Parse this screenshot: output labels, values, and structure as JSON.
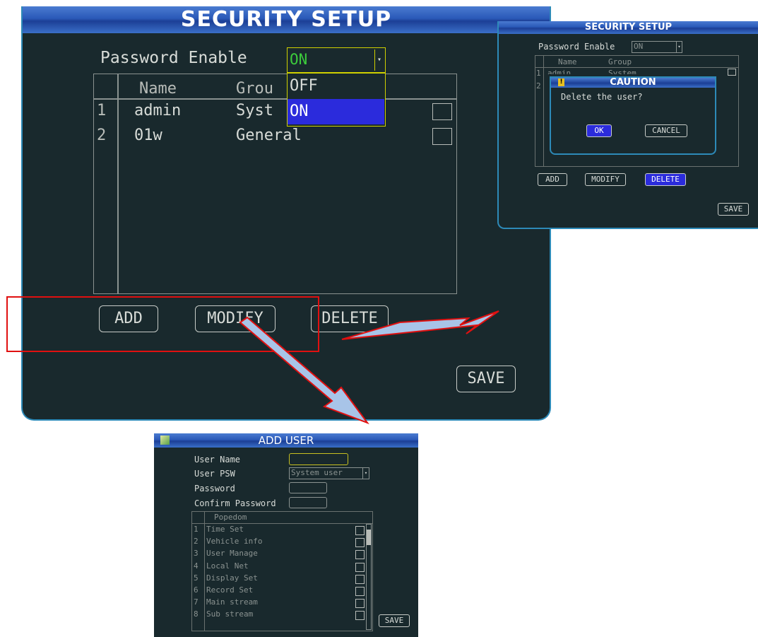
{
  "main": {
    "title": "SECURITY SETUP",
    "password_enable_label": "Password Enable",
    "password_enable_value": "ON",
    "dropdown_options": [
      "OFF",
      "ON"
    ],
    "col_name": "Name",
    "col_group_partial": "Grou",
    "rows": [
      {
        "num": "1",
        "name": "admin",
        "group_partial": "Syst"
      },
      {
        "num": "2",
        "name": "01w",
        "group": "General"
      }
    ],
    "add_label": "ADD",
    "modify_label": "MODIFY",
    "delete_label": "DELETE",
    "save_label": "SAVE"
  },
  "delete_dialog": {
    "title": "SECURITY SETUP",
    "password_enable_label": "Password Enable",
    "password_enable_value": "ON",
    "col_name": "Name",
    "col_group": "Group",
    "row_nums": [
      "1",
      "2"
    ],
    "row1_name_partial": "admin",
    "row1_group_partial": "System",
    "caution_title": "CAUTION",
    "caution_message": "Delete the user?",
    "ok_label": "OK",
    "cancel_label": "CANCEL",
    "add_label": "ADD",
    "modify_label": "MODIFY",
    "delete_label": "DELETE",
    "save_label": "SAVE"
  },
  "add_user": {
    "title": "ADD USER",
    "user_name_label": "User Name",
    "user_psw_label": "User PSW",
    "user_psw_value": "System user",
    "password_label": "Password",
    "confirm_password_label": "Confirm Password",
    "popedom_header": "Popedom",
    "popedom_items": [
      {
        "num": "1",
        "label": "Time Set"
      },
      {
        "num": "2",
        "label": "Vehicle info"
      },
      {
        "num": "3",
        "label": "User Manage"
      },
      {
        "num": "4",
        "label": "Local Net"
      },
      {
        "num": "5",
        "label": "Display Set"
      },
      {
        "num": "6",
        "label": "Record Set"
      },
      {
        "num": "7",
        "label": "Main stream"
      },
      {
        "num": "8",
        "label": "Sub stream"
      }
    ],
    "save_label": "SAVE"
  },
  "colors": {
    "panel_bg": "#19292d",
    "title_blue": "#2a59b8",
    "highlight": "#2b2bdc",
    "annotation_red": "#e01010",
    "arrow_fill": "#a8c4e8",
    "value_green": "#3ccc3c"
  }
}
